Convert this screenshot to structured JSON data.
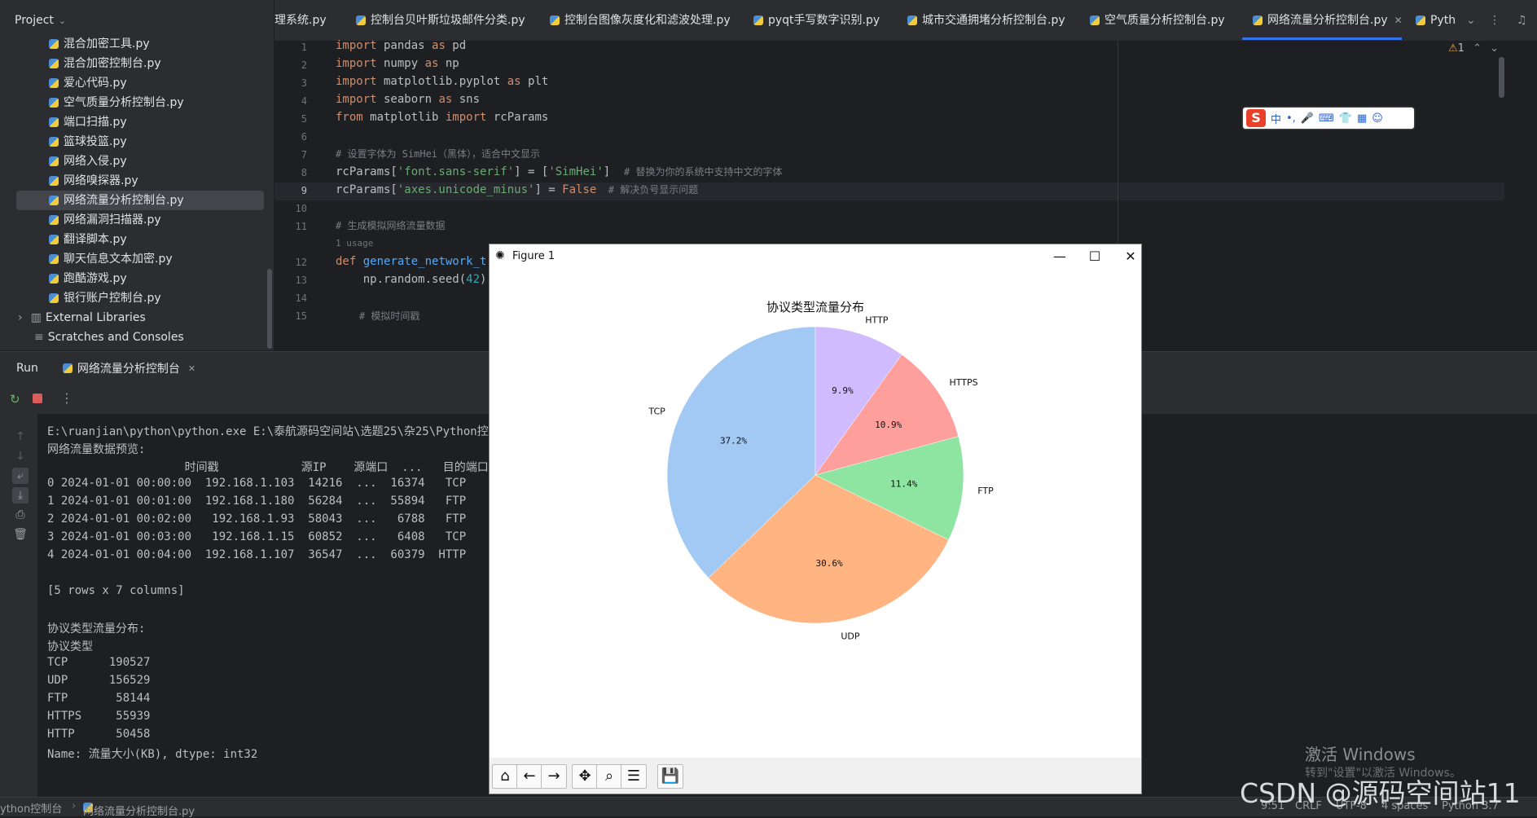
{
  "project_panel": {
    "title": "Project",
    "items": [
      "混合加密工具.py",
      "混合加密控制台.py",
      "爱心代码.py",
      "空气质量分析控制台.py",
      "端口扫描.py",
      "篮球投篮.py",
      "网络入侵.py",
      "网络嗅探器.py",
      "网络流量分析控制台.py",
      "网络漏洞扫描器.py",
      "翻译脚本.py",
      "聊天信息文本加密.py",
      "跑酷游戏.py",
      "银行账户控制台.py"
    ],
    "external_libraries": "External Libraries",
    "scratches": "Scratches and Consoles"
  },
  "tabs": [
    "理系统.py",
    "控制台贝叶斯垃圾邮件分类.py",
    "控制台图像灰度化和滤波处理.py",
    "pyqt手写数字识别.py",
    "城市交通拥堵分析控制台.py",
    "空气质量分析控制台.py",
    "网络流量分析控制台.py",
    "Pyth"
  ],
  "editor": {
    "warning_count": "1",
    "line_numbers": [
      "1",
      "2",
      "3",
      "4",
      "5",
      "6",
      "7",
      "8",
      "9",
      "10",
      "11",
      "12",
      "13",
      "14",
      "15"
    ],
    "usage_hint": "1 usage",
    "lines": {
      "l1a": "import",
      "l1b": " pandas ",
      "l1c": "as",
      "l1d": " pd",
      "l2a": "import",
      "l2b": " numpy ",
      "l2c": "as",
      "l2d": " np",
      "l3a": "import",
      "l3b": " matplotlib.pyplot ",
      "l3c": "as",
      "l3d": " plt",
      "l4a": "import",
      "l4b": " seaborn ",
      "l4c": "as",
      "l4d": " sns",
      "l5a": "from",
      "l5b": " matplotlib ",
      "l5c": "import",
      "l5d": " rcParams",
      "l7": "# 设置字体为 SimHei（黑体），适合中文显示",
      "l8a": "rcParams[",
      "l8b": "'font.sans-serif'",
      "l8c": "] = [",
      "l8d": "'SimHei'",
      "l8e": "]  ",
      "l8f": "# 替换为你的系统中支持中文的字体",
      "l9a": "rcParams[",
      "l9b": "'axes.unicode_minus'",
      "l9c": "] = ",
      "l9d": "False",
      "l9e": "  # 解决负号显示问题",
      "l11": "# 生成模拟网络流量数据",
      "l12a": "def",
      "l12b": " generate_network_tra",
      "l13a": "    np.random.seed(",
      "l13b": "42",
      "l13c": ")",
      "l15": "    # 模拟时间戳"
    }
  },
  "ime": {
    "logo": "S",
    "items": [
      "中",
      "•,",
      "🎤",
      "⌨",
      "👕",
      "▦",
      "☺"
    ]
  },
  "run": {
    "label": "Run",
    "tab": "网络流量分析控制台",
    "console": [
      "E:\\ruanjian\\python\\python.exe E:\\泰航源码空间站\\选题25\\杂25\\Python控制台\\",
      "网络流量数据预览:",
      "                    时间戳            源IP    源端口  ...   目的端口  协议类",
      "0 2024-01-01 00:00:00  192.168.1.103  14216  ...  16374   TCP     13",
      "1 2024-01-01 00:01:00  192.168.1.180  56284  ...  55894   FTP     18",
      "2 2024-01-01 00:02:00   192.168.1.93  58043  ...   6788   FTP      5",
      "3 2024-01-01 00:03:00   192.168.1.15  60852  ...   6408   TCP      4",
      "4 2024-01-01 00:04:00  192.168.1.107  36547  ...  60379  HTTP      9",
      "",
      "[5 rows x 7 columns]",
      "",
      "协议类型流量分布:",
      "协议类型",
      "TCP      190527",
      "UDP      156529",
      "FTP       58144",
      "HTTPS     55939",
      "HTTP      50458",
      "Name: 流量大小(KB), dtype: int32"
    ]
  },
  "figure": {
    "window_title": "Figure 1",
    "toolbar": [
      "home",
      "back",
      "forward",
      "pan",
      "zoom",
      "configure",
      "save"
    ]
  },
  "chart_data": {
    "type": "pie",
    "title": "协议类型流量分布",
    "categories": [
      "TCP",
      "UDP",
      "FTP",
      "HTTPS",
      "HTTP"
    ],
    "values": [
      37.2,
      30.6,
      11.4,
      10.9,
      9.9
    ],
    "labels": [
      "37.2%",
      "30.6%",
      "11.4%",
      "10.9%",
      "9.9%"
    ],
    "colors": [
      "#a1c9f4",
      "#ffb482",
      "#8de5a1",
      "#ff9f9b",
      "#d0bbff"
    ],
    "start_angle_deg": 90,
    "direction": "counterclockwise"
  },
  "status_bar": {
    "breadcrumb_1": "ython控制台",
    "breadcrumb_2": "网络流量分析控制台.py",
    "position": "9:51",
    "line_sep": "CRLF",
    "encoding": "UTF-8",
    "indent": "4 spaces",
    "interpreter": "Python 3.7"
  },
  "watermarks": {
    "activate": "激活 Windows",
    "activate_sub": "转到\"设置\"以激活 Windows。",
    "csdn": "CSDN @源码空间站11"
  }
}
